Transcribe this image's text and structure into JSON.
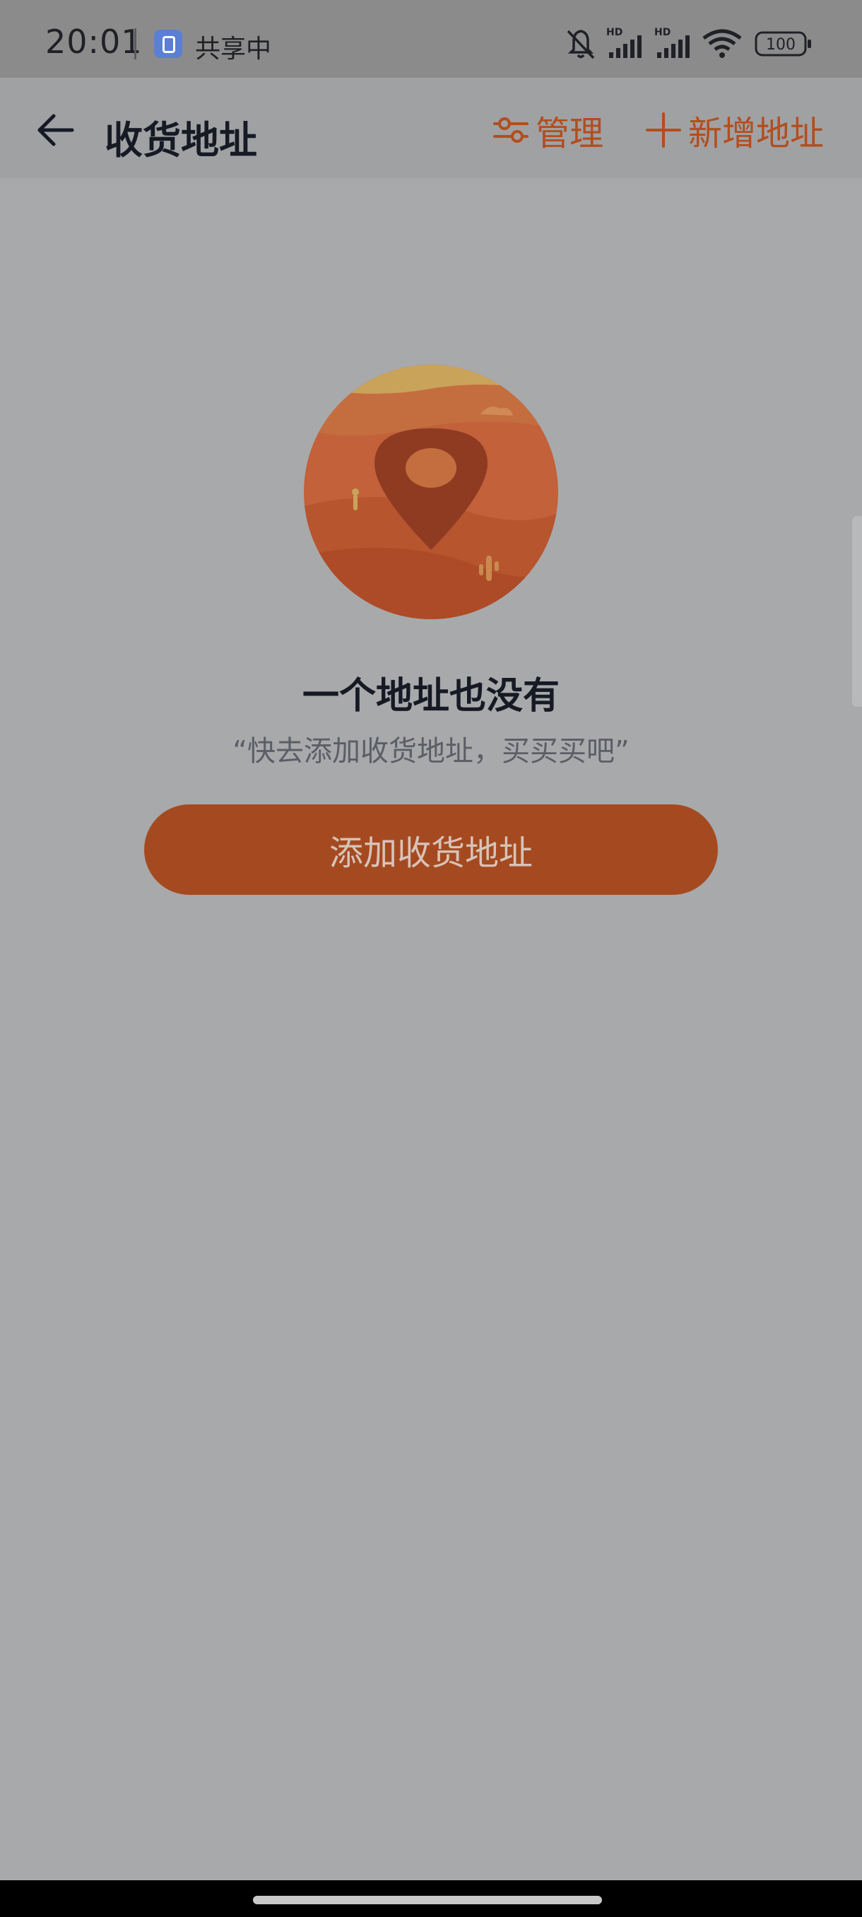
{
  "status_bar": {
    "time": "20:01",
    "share_text": "共享中",
    "icons": [
      "share-screen-icon",
      "bell-muted-icon",
      "signal-icon",
      "signal-icon",
      "wifi-icon",
      "battery-icon"
    ],
    "hd_label": "HD",
    "battery_level": "100"
  },
  "header": {
    "back_icon": "back-arrow-icon",
    "title": "收货地址",
    "manage_icon": "sliders-icon",
    "manage_label": "管理",
    "add_icon": "plus-icon",
    "add_label": "新增地址"
  },
  "empty_state": {
    "illustration": "location-pin-desert-illustration",
    "title": "一个地址也没有",
    "subtitle": "“快去添加收货地址，买买买吧”",
    "button_label": "添加收货地址"
  },
  "colors": {
    "accent": "#b24e1f",
    "button_bg": "#a54a20",
    "overlay_bg": "#a8a9ab"
  }
}
